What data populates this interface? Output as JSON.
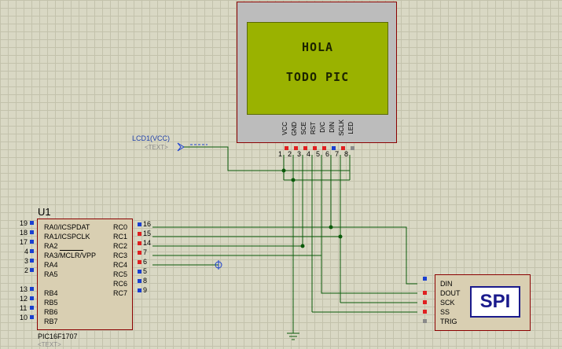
{
  "lcd": {
    "line1": "HOLA",
    "line2": "TODO PIC",
    "pins": [
      {
        "label": "VCC",
        "num": "1"
      },
      {
        "label": "GND",
        "num": "2"
      },
      {
        "label": "SCE",
        "num": "3"
      },
      {
        "label": "RST",
        "num": "4"
      },
      {
        "label": "D/C",
        "num": "5"
      },
      {
        "label": "DIN",
        "num": "6"
      },
      {
        "label": "SCLK",
        "num": "7"
      },
      {
        "label": "LED",
        "num": "8"
      }
    ],
    "power_label": "LCD1(VCC)",
    "power_text": "<TEXT>"
  },
  "ic": {
    "ref": "U1",
    "part": "PIC16F1707",
    "text": "<TEXT>",
    "left_pins": [
      {
        "num": "19",
        "label": "RA0/ICSPDAT"
      },
      {
        "num": "18",
        "label": "RA1/ICSPCLK"
      },
      {
        "num": "17",
        "label": "RA2"
      },
      {
        "num": "4",
        "label": "RA3/MCLR/VPP"
      },
      {
        "num": "3",
        "label": "RA4"
      },
      {
        "num": "2",
        "label": "RA5"
      },
      {
        "num": "13",
        "label": "RB4"
      },
      {
        "num": "12",
        "label": "RB5"
      },
      {
        "num": "11",
        "label": "RB6"
      },
      {
        "num": "10",
        "label": "RB7"
      }
    ],
    "right_pins": [
      {
        "num": "16",
        "label": "RC0"
      },
      {
        "num": "15",
        "label": "RC1"
      },
      {
        "num": "14",
        "label": "RC2"
      },
      {
        "num": "7",
        "label": "RC3"
      },
      {
        "num": "6",
        "label": "RC4"
      },
      {
        "num": "5",
        "label": "RC5"
      },
      {
        "num": "8",
        "label": "RC6"
      },
      {
        "num": "9",
        "label": "RC7"
      }
    ]
  },
  "spi": {
    "badge": "SPI",
    "pins": [
      "DIN",
      "DOUT",
      "SCK",
      "SS",
      "TRIG"
    ]
  },
  "colors": {
    "wire": "#0a5a0a",
    "pin_blue": "#1a3fd0",
    "pin_red": "#e02020",
    "pin_gray": "#8a8a8a",
    "lcd_screen": "#9ab200"
  }
}
